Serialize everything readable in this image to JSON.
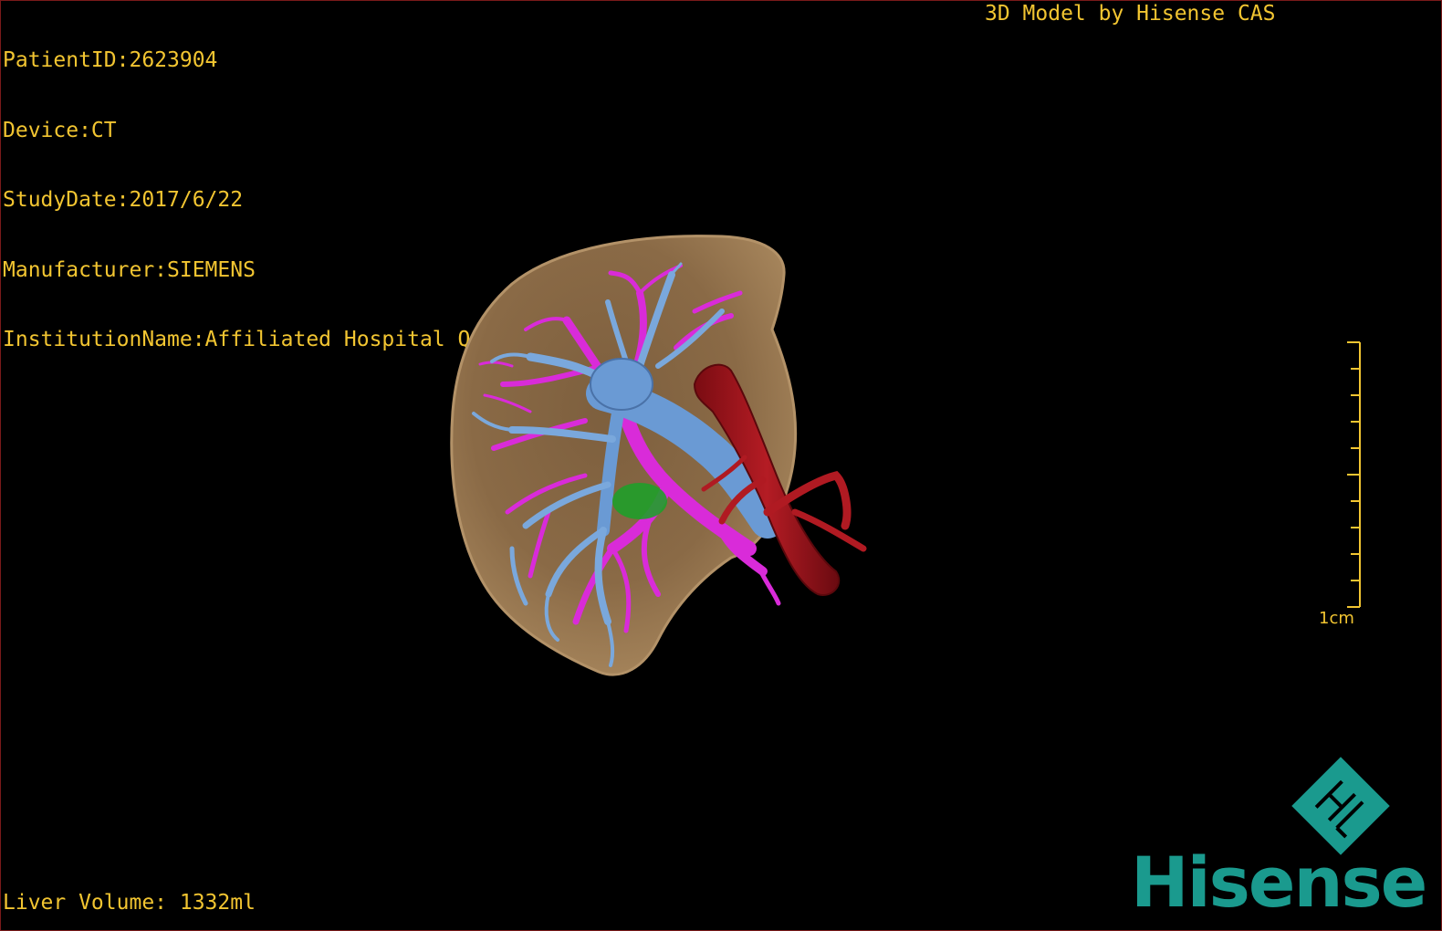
{
  "overlay": {
    "patient_id": "PatientID:2623904",
    "device": "Device:CT",
    "study_date": "StudyDate:2017/6/22",
    "manufacturer": "Manufacturer:SIEMENS",
    "institution": "InstitutionName:Affiliated Hospital Qingdao University-C",
    "credit": "3D Model by Hisense CAS",
    "liver_volume": "Liver Volume: 1332ml"
  },
  "scale_bar": {
    "label": "1cm"
  },
  "logo": {
    "brand": "Hisense",
    "icon": "hisense-cas-diamond-icon"
  },
  "colors": {
    "overlay_text": "#f2c531",
    "liver": "#8a6a46",
    "portal_vein": "#6fa0d8",
    "hepatic_vein": "#d92bd9",
    "ivc": "#a81820",
    "gallbladder": "#1f9e2a",
    "brand": "#1a9a8e"
  },
  "model": {
    "structures": [
      "liver",
      "portal-vein",
      "hepatic-vein",
      "inferior-vena-cava",
      "gallbladder"
    ]
  }
}
